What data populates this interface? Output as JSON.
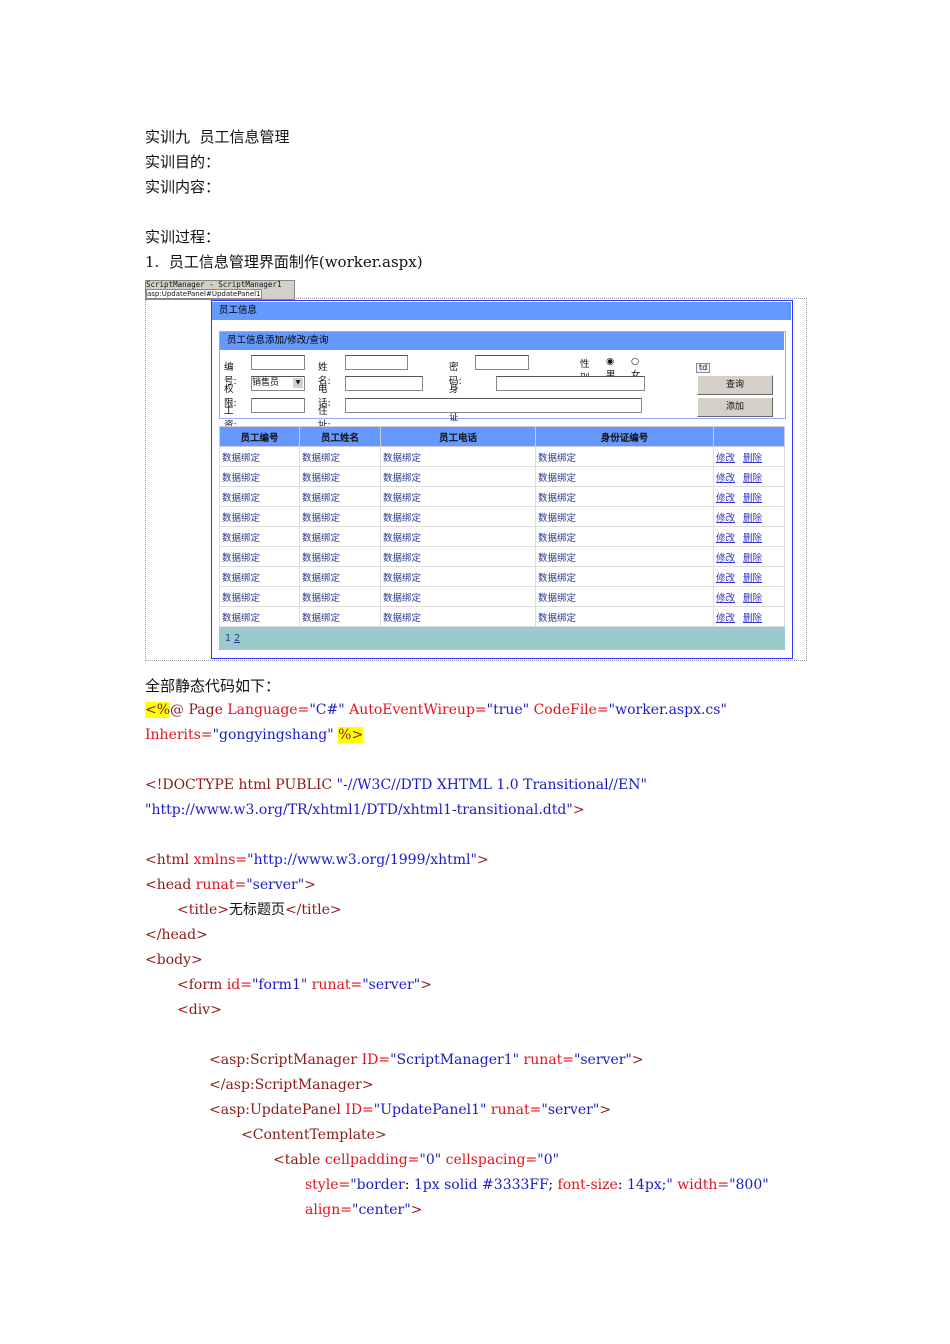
{
  "doc": {
    "lines": [
      "实训九  员工信息管理",
      "实训目的：",
      "实训内容：",
      "实训过程：",
      "1.  员工信息管理界面制作(worker.aspx)"
    ],
    "code_intro": "全部静态代码如下："
  },
  "screenshot": {
    "script_manager": "ScriptManager - ScriptManager1",
    "update_panel": "asp:UpdatePanel#UpdatePanel1",
    "panel_title": "员工信息",
    "form_title": "员工信息添加/修改/查询",
    "labels": {
      "id": "编号:",
      "name": "姓名:",
      "password": "密码:",
      "gender": "性别:",
      "male": "男",
      "female": "女",
      "role": "权限:",
      "phone": "电话:",
      "idcard": "身份证号:",
      "salary": "工资:",
      "address": "住址:"
    },
    "role_value": "销售员",
    "td_tag": "td",
    "query_button": "查询",
    "add_button": "添加",
    "columns": [
      "员工编号",
      "员工姓名",
      "员工电话",
      "身份证编号",
      ""
    ],
    "cell": "数据绑定",
    "edit": "修改",
    "delete": "删除",
    "row_count": 10,
    "pager": [
      "1",
      "2"
    ],
    "colors": {
      "header": "#6699ff",
      "pager": "#9cc9cc",
      "border": "#3333ff"
    }
  },
  "code": [
    {
      "i": 0,
      "s": [
        [
          "<%",
          "h"
        ],
        [
          "@ Page ",
          "t"
        ],
        [
          "Language=",
          "a"
        ],
        [
          "\"C#\"",
          "v"
        ],
        [
          " AutoEventWireup=",
          "a"
        ],
        [
          "\"true\"",
          "v"
        ],
        [
          " CodeFile=",
          "a"
        ],
        [
          "\"worker.aspx.cs\"",
          "v"
        ]
      ]
    },
    {
      "i": 0,
      "s": [
        [
          "Inherits=",
          "a"
        ],
        [
          "\"gongyingshang\"",
          "v"
        ],
        [
          " ",
          "x"
        ],
        [
          "%>",
          "h"
        ]
      ]
    },
    {
      "i": 0,
      "s": []
    },
    {
      "i": 0,
      "s": [
        [
          "<!DOCTYPE html PUBLIC ",
          "t"
        ],
        [
          "\"-//W3C//DTD XHTML 1.0 Transitional//EN\"",
          "v"
        ]
      ]
    },
    {
      "i": 0,
      "s": [
        [
          "\"http://www.w3.org/TR/xhtml1/DTD/xhtml1-transitional.dtd\"",
          "v"
        ],
        [
          ">",
          "t"
        ]
      ]
    },
    {
      "i": 0,
      "s": []
    },
    {
      "i": 0,
      "s": [
        [
          "<html ",
          "t"
        ],
        [
          "xmlns=",
          "a"
        ],
        [
          "\"http://www.w3.org/1999/xhtml\"",
          "v"
        ],
        [
          ">",
          "t"
        ]
      ]
    },
    {
      "i": 0,
      "s": [
        [
          "<head ",
          "t"
        ],
        [
          "runat=",
          "a"
        ],
        [
          "\"server\"",
          "v"
        ],
        [
          ">",
          "t"
        ]
      ]
    },
    {
      "i": 1,
      "s": [
        [
          "<title>",
          "t"
        ],
        [
          "无标题页",
          "x"
        ],
        [
          "</title>",
          "t"
        ]
      ]
    },
    {
      "i": 0,
      "s": [
        [
          "</head>",
          "t"
        ]
      ]
    },
    {
      "i": 0,
      "s": [
        [
          "<body>",
          "t"
        ]
      ]
    },
    {
      "i": 1,
      "s": [
        [
          "<form ",
          "t"
        ],
        [
          "id=",
          "a"
        ],
        [
          "\"form1\"",
          "v"
        ],
        [
          " runat=",
          "a"
        ],
        [
          "\"server\"",
          "v"
        ],
        [
          ">",
          "t"
        ]
      ]
    },
    {
      "i": 1,
      "s": [
        [
          "<div>",
          "t"
        ]
      ]
    },
    {
      "i": 0,
      "s": []
    },
    {
      "i": 2,
      "s": [
        [
          "<asp:ScriptManager ",
          "t"
        ],
        [
          "ID=",
          "a"
        ],
        [
          "\"ScriptManager1\"",
          "v"
        ],
        [
          " runat=",
          "a"
        ],
        [
          "\"server\"",
          "v"
        ],
        [
          ">",
          "t"
        ]
      ]
    },
    {
      "i": 2,
      "s": [
        [
          "</asp:ScriptManager>",
          "t"
        ]
      ]
    },
    {
      "i": 2,
      "s": [
        [
          "<asp:UpdatePanel ",
          "t"
        ],
        [
          "ID=",
          "a"
        ],
        [
          "\"UpdatePanel1\"",
          "v"
        ],
        [
          " runat=",
          "a"
        ],
        [
          "\"server\"",
          "v"
        ],
        [
          ">",
          "t"
        ]
      ]
    },
    {
      "i": 3,
      "s": [
        [
          "<ContentTemplate>",
          "t"
        ]
      ]
    },
    {
      "i": 4,
      "s": [
        [
          "<table ",
          "t"
        ],
        [
          "cellpadding=",
          "a"
        ],
        [
          "\"0\"",
          "v"
        ],
        [
          " cellspacing=",
          "a"
        ],
        [
          "\"0\"",
          "v"
        ]
      ]
    },
    {
      "i": 5,
      "s": [
        [
          "style=",
          "a"
        ],
        [
          "\"border",
          "v"
        ],
        [
          ": ",
          "x"
        ],
        [
          "1px solid #3333FF",
          "v"
        ],
        [
          "; ",
          "x"
        ],
        [
          "font-size",
          "a"
        ],
        [
          ": ",
          "x"
        ],
        [
          "14px;\"",
          "v"
        ],
        [
          " width=",
          "a"
        ],
        [
          "\"800\"",
          "v"
        ]
      ]
    },
    {
      "i": 5,
      "s": [
        [
          "align=",
          "a"
        ],
        [
          "\"center\"",
          "v"
        ],
        [
          ">",
          "t"
        ]
      ]
    }
  ]
}
